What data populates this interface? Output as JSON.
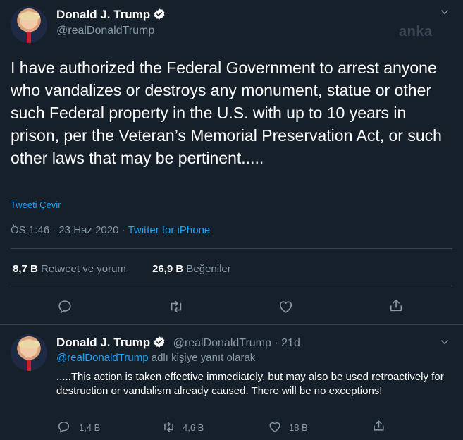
{
  "watermark": "anka",
  "main_tweet": {
    "author_name": "Donald J. Trump",
    "author_handle": "@realDonaldTrump",
    "text": "I have authorized the Federal Government to arrest anyone who vandalizes or destroys any monument, statue or other such Federal property in the U.S. with up to 10 years in prison, per the Veteran’s Memorial Preservation Act, or such other laws that may be pertinent.....",
    "translate_label": "Tweeti Çevir",
    "time": "ÖS 1:46",
    "date": "23 Haz 2020",
    "source": "Twitter for iPhone",
    "retweets_count": "8,7 B",
    "retweets_label": "Retweet ve yorum",
    "likes_count": "26,9 B",
    "likes_label": "Beğeniler",
    "actions": {
      "reply_icon": "reply-icon",
      "retweet_icon": "retweet-icon",
      "like_icon": "heart-icon",
      "share_icon": "share-icon"
    }
  },
  "reply_tweet": {
    "author_name": "Donald J. Trump",
    "author_handle": "@realDonaldTrump",
    "time_ago": "21d",
    "replying_to_handle": "@realDonaldTrump",
    "replying_to_suffix": "adlı kişiye yanıt olarak",
    "text": ".....This action is taken effective immediately, but may also be used retroactively for destruction or vandalism already caused. There will be no exceptions!",
    "reply_count": "1,4 B",
    "retweet_count": "4,6 B",
    "like_count": "18 B"
  },
  "colors": {
    "background": "#15202b",
    "accent": "#1da1f2",
    "muted": "#8899a6",
    "divider": "#38444d"
  }
}
